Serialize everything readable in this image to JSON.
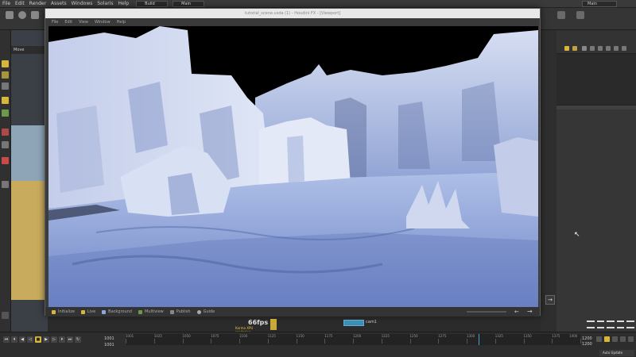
{
  "menubar": {
    "items": [
      "File",
      "Edit",
      "Render",
      "Assets",
      "Windows",
      "Solaris",
      "Help"
    ],
    "desktop_left": "Build",
    "desktop_mid": "Main",
    "desktop_right": "Main"
  },
  "left_pane": {
    "tab_label": "Move"
  },
  "window": {
    "title": "tutorial_scene.usda (1) - Houdini FX - [Viewport]",
    "menu": [
      "File",
      "Edit",
      "View",
      "Window",
      "Help"
    ],
    "status_items": [
      "Initialize",
      "Live",
      "Background",
      "Multiview",
      "Publish",
      "Guide"
    ]
  },
  "viewport": {
    "fps": "66fps",
    "fps_sub": "Karma XPU rendering",
    "camera_label": "cam1"
  },
  "timeline": {
    "frame_current": "1001",
    "frame_start": "1001",
    "frame_end": "1200",
    "frame_end_sub": "1200",
    "auto_update": "Auto Update",
    "ticks": [
      "1001",
      "1025",
      "1050",
      "1075",
      "1100",
      "1125",
      "1150",
      "1175",
      "1200",
      "1225",
      "1250",
      "1275",
      "1300",
      "1325",
      "1350",
      "1375",
      "1400"
    ]
  },
  "colors": {
    "accent_yellow": "#d6b73b",
    "accent_blue": "#3b8fb5",
    "ice": "#b7c6e6",
    "sky": "#000000"
  }
}
